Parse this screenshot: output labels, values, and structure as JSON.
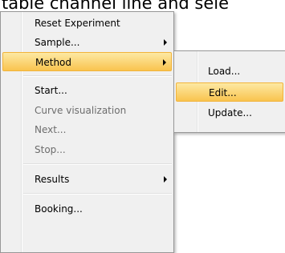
{
  "background": {
    "partial_text": "table channel line and sele"
  },
  "main_menu": {
    "items": [
      {
        "label": "Reset Experiment"
      },
      {
        "label": "Sample..."
      },
      {
        "label": "Method"
      },
      {
        "label": "Start..."
      },
      {
        "label": "Curve visualization"
      },
      {
        "label": "Next..."
      },
      {
        "label": "Stop..."
      },
      {
        "label": "Results"
      },
      {
        "label": "Booking..."
      }
    ]
  },
  "sub_menu": {
    "items": [
      {
        "label": "Load..."
      },
      {
        "label": "Edit..."
      },
      {
        "label": "Update..."
      }
    ]
  },
  "colors": {
    "menu_bg": "#f0f0f0",
    "highlight_top": "#fde9a3",
    "highlight_bottom": "#f9c44f",
    "disabled_text": "#6d6d6d"
  }
}
